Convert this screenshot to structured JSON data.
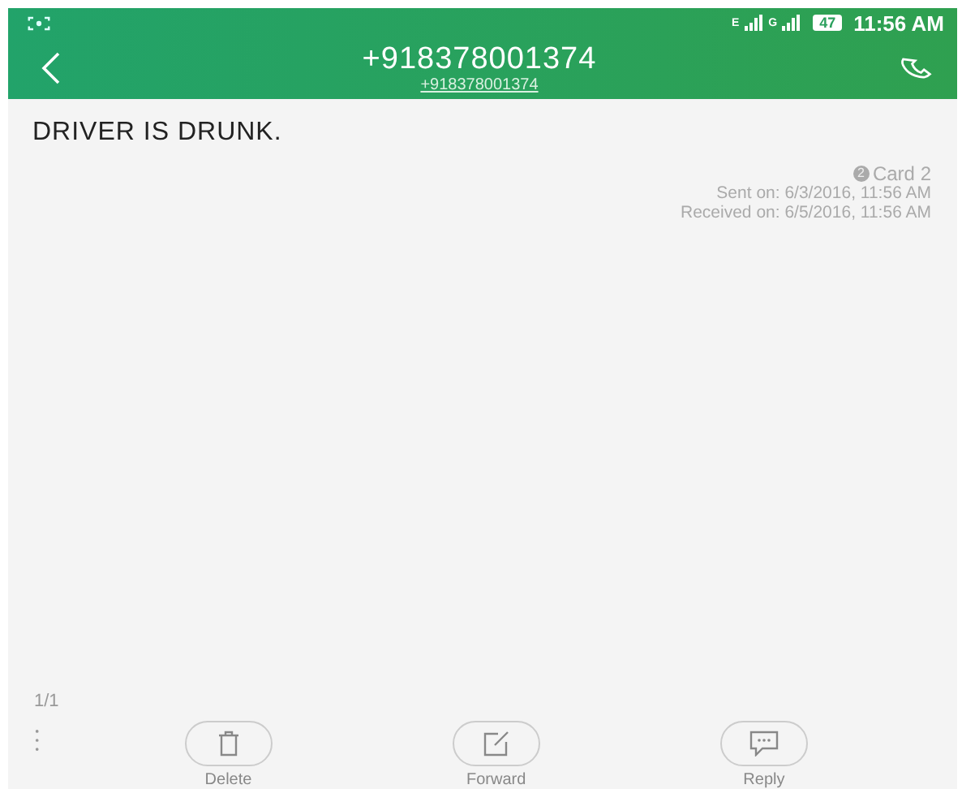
{
  "status_bar": {
    "networks": [
      "E",
      "G"
    ],
    "battery": "47",
    "time": "11:56 AM"
  },
  "header": {
    "title": "+918378001374",
    "subtitle": "+918378001374"
  },
  "message": {
    "text": "DRIVER IS DRUNK.",
    "sim_badge": "2",
    "sim": "Card 2",
    "sent": "Sent on: 6/3/2016, 11:56 AM",
    "received": "Received on: 6/5/2016, 11:56 AM"
  },
  "page_counter": "1/1",
  "actions": [
    {
      "kind": "delete",
      "label": "Delete"
    },
    {
      "kind": "forward",
      "label": "Forward"
    },
    {
      "kind": "reply",
      "label": "Reply"
    }
  ]
}
